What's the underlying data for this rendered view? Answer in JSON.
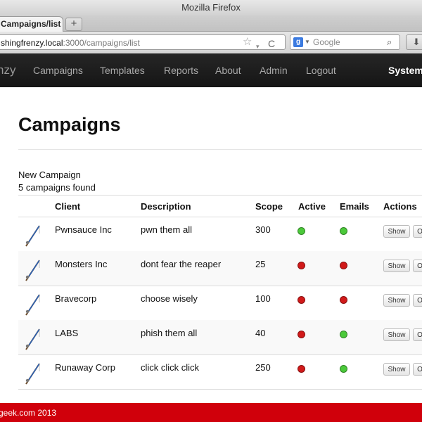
{
  "window": {
    "title": "Mozilla Firefox"
  },
  "browser": {
    "tab_label": "Campaigns/list",
    "new_tab": "+",
    "url_host": "shingfrenzy.local",
    "url_path": ":3000/campaigns/list",
    "search_placeholder": "Google",
    "google_glyph": "g",
    "icons": {
      "star": "☆",
      "dropmark": "▾",
      "reload": "C",
      "magnifier": "⌕",
      "download": "⬇"
    }
  },
  "app": {
    "brand": "nzy",
    "nav": [
      "Campaigns",
      "Templates",
      "Reports",
      "About",
      "Admin",
      "Logout"
    ],
    "nav_right": "System"
  },
  "page": {
    "title": "Campaigns",
    "new_link": "New Campaign",
    "found_text": "5 campaigns found"
  },
  "table": {
    "headers": {
      "client": "Client",
      "description": "Description",
      "scope": "Scope",
      "active": "Active",
      "emails": "Emails",
      "actions": "Actions"
    },
    "rows": [
      {
        "client": "Pwnsauce Inc",
        "description": "pwn them all",
        "scope": "300",
        "active": true,
        "emails": true
      },
      {
        "client": "Monsters Inc",
        "description": "dont fear the reaper",
        "scope": "25",
        "active": false,
        "emails": false
      },
      {
        "client": "Bravecorp",
        "description": "choose wisely",
        "scope": "100",
        "active": false,
        "emails": false
      },
      {
        "client": "LABS",
        "description": "phish them all",
        "scope": "40",
        "active": false,
        "emails": true
      },
      {
        "client": "Runaway Corp",
        "description": "click click click",
        "scope": "250",
        "active": false,
        "emails": true
      }
    ],
    "show_label": "Show",
    "second_action_label": "O"
  },
  "colors": {
    "on": "#4bc93a",
    "off": "#d11a1a",
    "footer": "#d0000b"
  },
  "footer": {
    "text": "geek.com 2013"
  }
}
